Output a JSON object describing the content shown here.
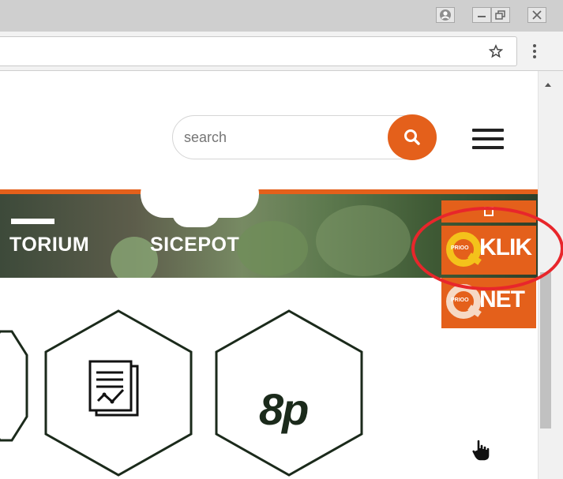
{
  "browser": {
    "window_buttons": [
      "profile-icon",
      "minimize-icon",
      "restore-icon",
      "close-icon"
    ],
    "bookmark_icon": "star-icon",
    "menu_icon": "kebab-menu-icon"
  },
  "header": {
    "search": {
      "placeholder": "search",
      "button_icon": "search-icon"
    },
    "menu_icon": "hamburger-menu-icon"
  },
  "banner": {
    "items": [
      "TORIUM",
      "SICEPOT"
    ],
    "accent_color": "#e4601b"
  },
  "widgets": [
    {
      "brand": "PRIOO",
      "name": "KLIK",
      "highlighted": true
    },
    {
      "brand": "PRIOO",
      "name": "NET",
      "highlighted": false
    }
  ],
  "services": [
    {
      "icon": "partial-hexagon-icon"
    },
    {
      "icon": "report-chart-icon"
    },
    {
      "label": "8p"
    }
  ],
  "colors": {
    "brand_orange": "#e4601b",
    "highlight_red": "#e8262b",
    "dark_green": "#1b2a1b"
  }
}
